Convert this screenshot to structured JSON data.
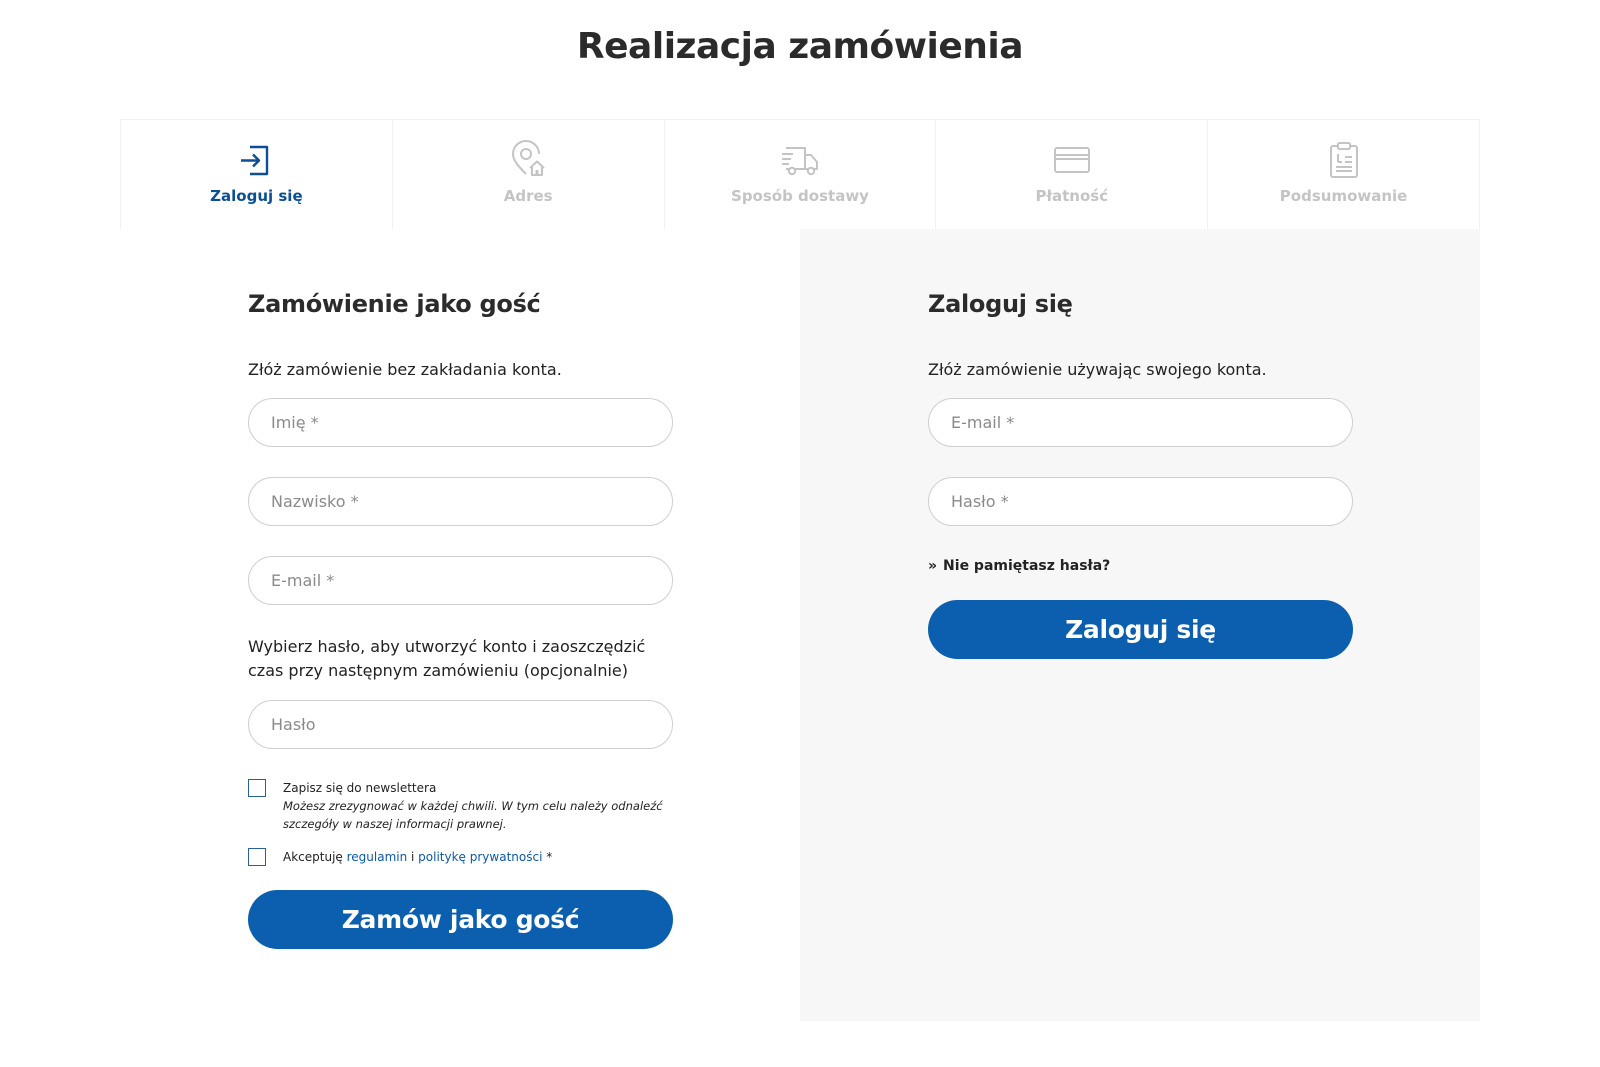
{
  "page": {
    "title": "Realizacja zamówienia"
  },
  "steps": [
    {
      "label": "Zaloguj się",
      "icon": "login-icon",
      "active": true
    },
    {
      "label": "Adres",
      "icon": "location-home-icon",
      "active": false
    },
    {
      "label": "Sposób dostawy",
      "icon": "delivery-truck-icon",
      "active": false
    },
    {
      "label": "Płatność",
      "icon": "credit-card-icon",
      "active": false
    },
    {
      "label": "Podsumowanie",
      "icon": "summary-document-icon",
      "active": false
    }
  ],
  "guest": {
    "heading": "Zamówienie jako gość",
    "subtitle": "Złóż zamówienie bez zakładania konta.",
    "first_name_placeholder": "Imię *",
    "last_name_placeholder": "Nazwisko *",
    "email_placeholder": "E-mail *",
    "password_hint": "Wybierz hasło, aby utworzyć konto i zaoszczędzić czas przy następnym zamówieniu (opcjonalnie)",
    "password_placeholder": "Hasło",
    "newsletter_label": "Zapisz się do newslettera",
    "newsletter_note": "Możesz zrezygnować w każdej chwili. W tym celu należy odnaleźć szczegóły w naszej informacji prawnej.",
    "terms_prefix": "Akceptuję ",
    "terms_link": "regulamin",
    "terms_and": " i ",
    "privacy_link": "politykę prywatności",
    "terms_suffix": " *",
    "submit_label": "Zamów jako gość"
  },
  "login": {
    "heading": "Zaloguj się",
    "subtitle": "Złóż zamówienie używając swojego konta.",
    "email_placeholder": "E-mail *",
    "password_placeholder": "Hasło *",
    "forgot_marker": "»",
    "forgot_label": "Nie pamiętasz hasła?",
    "submit_label": "Zaloguj się"
  },
  "colors": {
    "accent": "#0b5fae",
    "active_step": "#0c4f95",
    "inactive_step": "#c4c4c4",
    "panel_background": "#f7f7f7"
  }
}
